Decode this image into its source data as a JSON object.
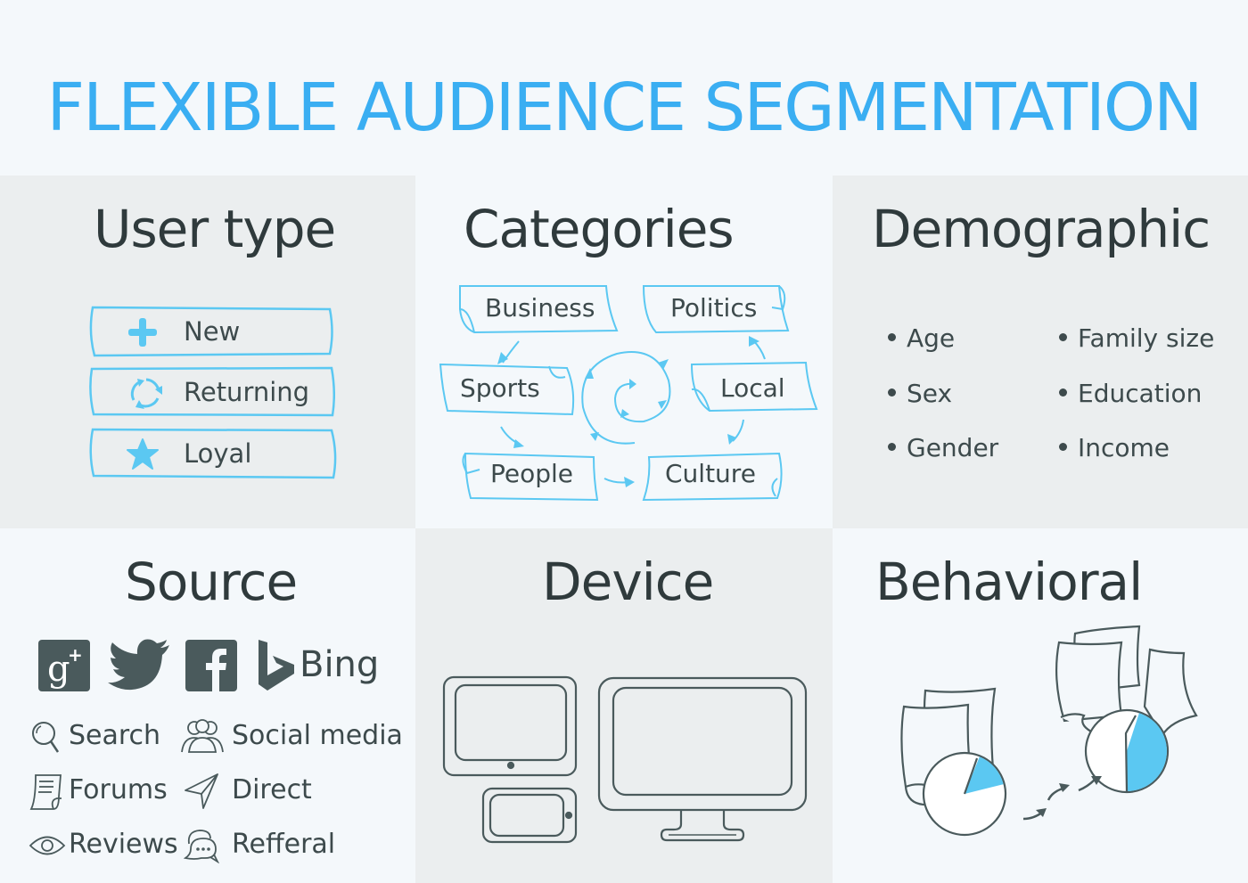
{
  "title": "FLEXIBLE AUDIENCE SEGMENTATION",
  "colors": {
    "accent": "#3aaef2",
    "icon_blue": "#5bc8f2",
    "text_dark": "#3d4a4c",
    "panel_gray": "#ebeeef",
    "panel_light": "#f4f8fb"
  },
  "panels": {
    "user_type": {
      "heading": "User type",
      "items": [
        {
          "label": "New",
          "icon": "plus-icon"
        },
        {
          "label": "Returning",
          "icon": "cycle-arrows-icon"
        },
        {
          "label": "Loyal",
          "icon": "star-icon"
        }
      ]
    },
    "categories": {
      "heading": "Categories",
      "items": [
        "Business",
        "Politics",
        "Sports",
        "Local",
        "People",
        "Culture"
      ]
    },
    "demographic": {
      "heading": "Demographic",
      "left": [
        "Age",
        "Sex",
        "Gender"
      ],
      "right": [
        "Family size",
        "Education",
        "Income"
      ]
    },
    "source": {
      "heading": "Source",
      "brands": [
        "google-plus-icon",
        "twitter-icon",
        "facebook-icon",
        "bing-icon"
      ],
      "bing_label": "Bing",
      "items": [
        {
          "label": "Search",
          "icon": "magnifier-icon"
        },
        {
          "label": "Social media",
          "icon": "people-icon"
        },
        {
          "label": "Forums",
          "icon": "scroll-icon"
        },
        {
          "label": "Direct",
          "icon": "paper-plane-icon"
        },
        {
          "label": "Reviews",
          "icon": "eye-icon"
        },
        {
          "label": "Refferal",
          "icon": "chat-bubbles-icon"
        }
      ]
    },
    "device": {
      "heading": "Device",
      "devices": [
        "tablet-icon",
        "phone-icon",
        "monitor-icon"
      ]
    },
    "behavioral": {
      "heading": "Behavioral",
      "progress": {
        "before": 0.15,
        "after": 0.45
      }
    }
  }
}
